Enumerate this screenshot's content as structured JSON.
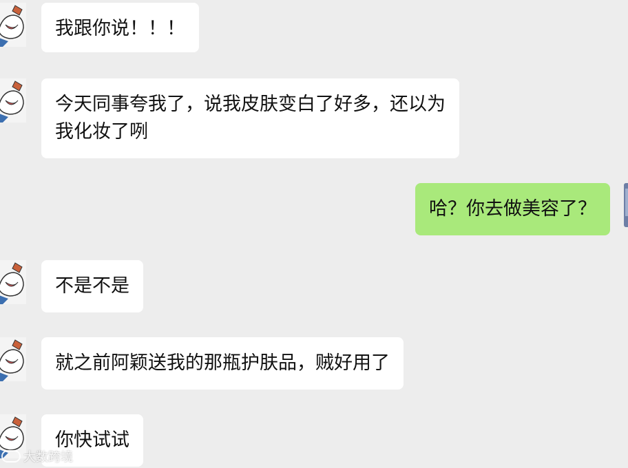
{
  "messages": [
    {
      "side": "left",
      "lines": [
        "我跟你说！！！"
      ]
    },
    {
      "side": "left",
      "lines": [
        "今天同事夸我了，说我皮肤变白了好多，还以为",
        "我化妆了咧"
      ]
    },
    {
      "side": "right",
      "lines": [
        "哈？你去做美容了？"
      ]
    },
    {
      "side": "left",
      "lines": [
        "不是不是"
      ]
    },
    {
      "side": "left",
      "lines": [
        "就之前阿颖送我的那瓶护肤品，贼好用了"
      ]
    },
    {
      "side": "left",
      "lines": [
        "你快试试"
      ]
    }
  ],
  "watermark": {
    "text": "大数跨境"
  },
  "colors": {
    "background": "#ededed",
    "bubble_in": "#ffffff",
    "bubble_out": "#a9e97b"
  }
}
